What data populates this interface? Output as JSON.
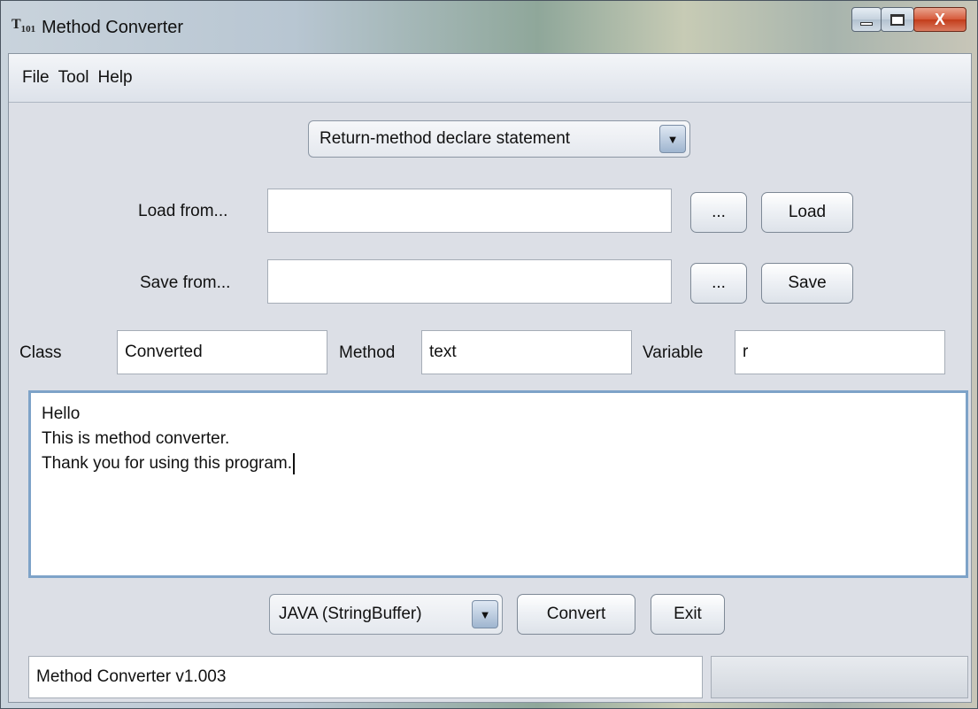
{
  "window": {
    "title": "Method Converter",
    "icon_text": "T₁₀₁",
    "close_glyph": "X"
  },
  "menu": [
    "File",
    "Tool",
    "Help"
  ],
  "statement_type": {
    "selected": "Return-method declare statement"
  },
  "load": {
    "label": "Load from...",
    "value": "",
    "browse_label": "...",
    "button_label": "Load"
  },
  "save": {
    "label": "Save from...",
    "value": "",
    "browse_label": "...",
    "button_label": "Save"
  },
  "names": {
    "class_label": "Class",
    "class_value": "Converted",
    "method_label": "Method",
    "method_value": "text",
    "variable_label": "Variable",
    "variable_value": "r"
  },
  "editor": {
    "lines": [
      "Hello",
      "This is method converter.",
      "Thank you for using this program."
    ]
  },
  "output_format": {
    "selected": "JAVA (StringBuffer)"
  },
  "actions": {
    "convert_label": "Convert",
    "exit_label": "Exit"
  },
  "status": {
    "text": "Method Converter v1.003"
  },
  "icons": {
    "dropdown": "triangle-down",
    "minimize": "minimize",
    "maximize": "maximize",
    "close": "close-x"
  }
}
